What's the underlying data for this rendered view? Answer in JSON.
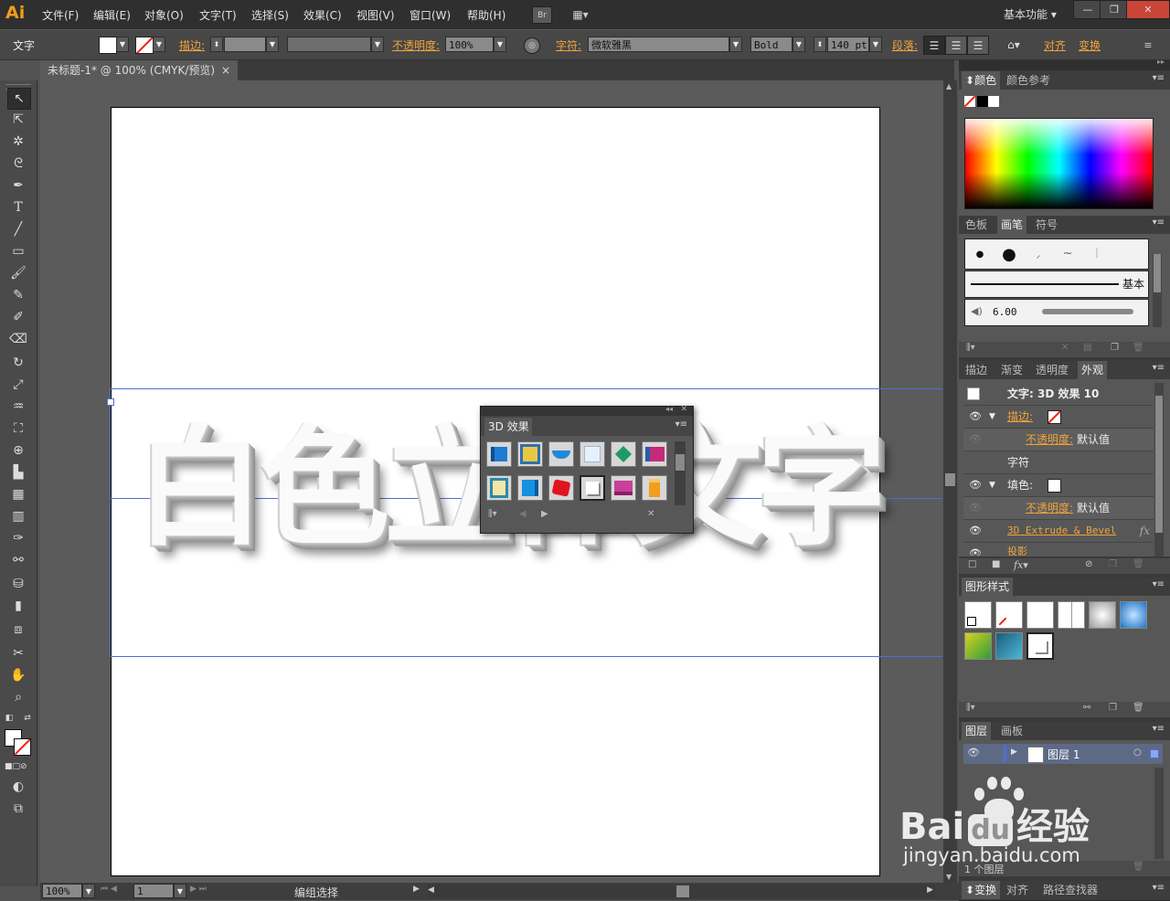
{
  "app": {
    "logo": "Ai"
  },
  "menu": [
    "文件(F)",
    "编辑(E)",
    "对象(O)",
    "文字(T)",
    "选择(S)",
    "效果(C)",
    "视图(V)",
    "窗口(W)",
    "帮助(H)"
  ],
  "bridge_label": "Br",
  "workspace": "基本功能",
  "control": {
    "tool_label": "文字",
    "stroke_label": "描边:",
    "opacity_label": "不透明度:",
    "opacity_value": "100%",
    "char_label": "字符:",
    "font_family": "微软雅黑",
    "font_style": "Bold",
    "font_size": "140 pt",
    "para_label": "段落:",
    "align_label": "对齐",
    "transform_label": "变换"
  },
  "document": {
    "tab_title": "未标题-1* @ 100% (CMYK/预览)",
    "close": "×"
  },
  "artwork_text": "白色立体文字",
  "fx3d_panel": {
    "title": "3D 效果"
  },
  "status": {
    "zoom": "100%",
    "artboard": "1",
    "mode": "编组选择"
  },
  "panels": {
    "color": {
      "tabs": [
        "颜色",
        "颜色参考"
      ]
    },
    "brushes": {
      "tabs": [
        "色板",
        "画笔",
        "符号"
      ],
      "basic_label": "基本",
      "size_value": "6.00"
    },
    "appearance": {
      "tabs": [
        "描边",
        "渐变",
        "透明度",
        "外观"
      ],
      "header": "文字: 3D 效果 10",
      "rows": {
        "stroke": "描边:",
        "stroke_opacity_label": "不透明度:",
        "stroke_opacity_value": "默认值",
        "characters": "字符",
        "fill": "填色:",
        "fill_opacity_label": "不透明度:",
        "fill_opacity_value": "默认值",
        "effect_3d": "3D Extrude & Bevel",
        "effect_shadow": "投影",
        "fx": "fx"
      }
    },
    "graphic_styles": {
      "tabs": [
        "图形样式"
      ]
    },
    "layers": {
      "tabs": [
        "图层",
        "画板"
      ],
      "layer_name": "图层 1",
      "count": "1 个图层"
    },
    "bottom": {
      "tabs": [
        "变换",
        "对齐",
        "路径查找器"
      ]
    }
  },
  "watermark": {
    "brand": "Bai",
    "brand2": "du",
    "brand3": "经验",
    "url": "jingyan.baidu.com"
  },
  "colors": {
    "accent": "#f0a33a",
    "ui_dark": "#2f2f2f",
    "ui_mid": "#474747",
    "guide": "#4f6fd0"
  }
}
